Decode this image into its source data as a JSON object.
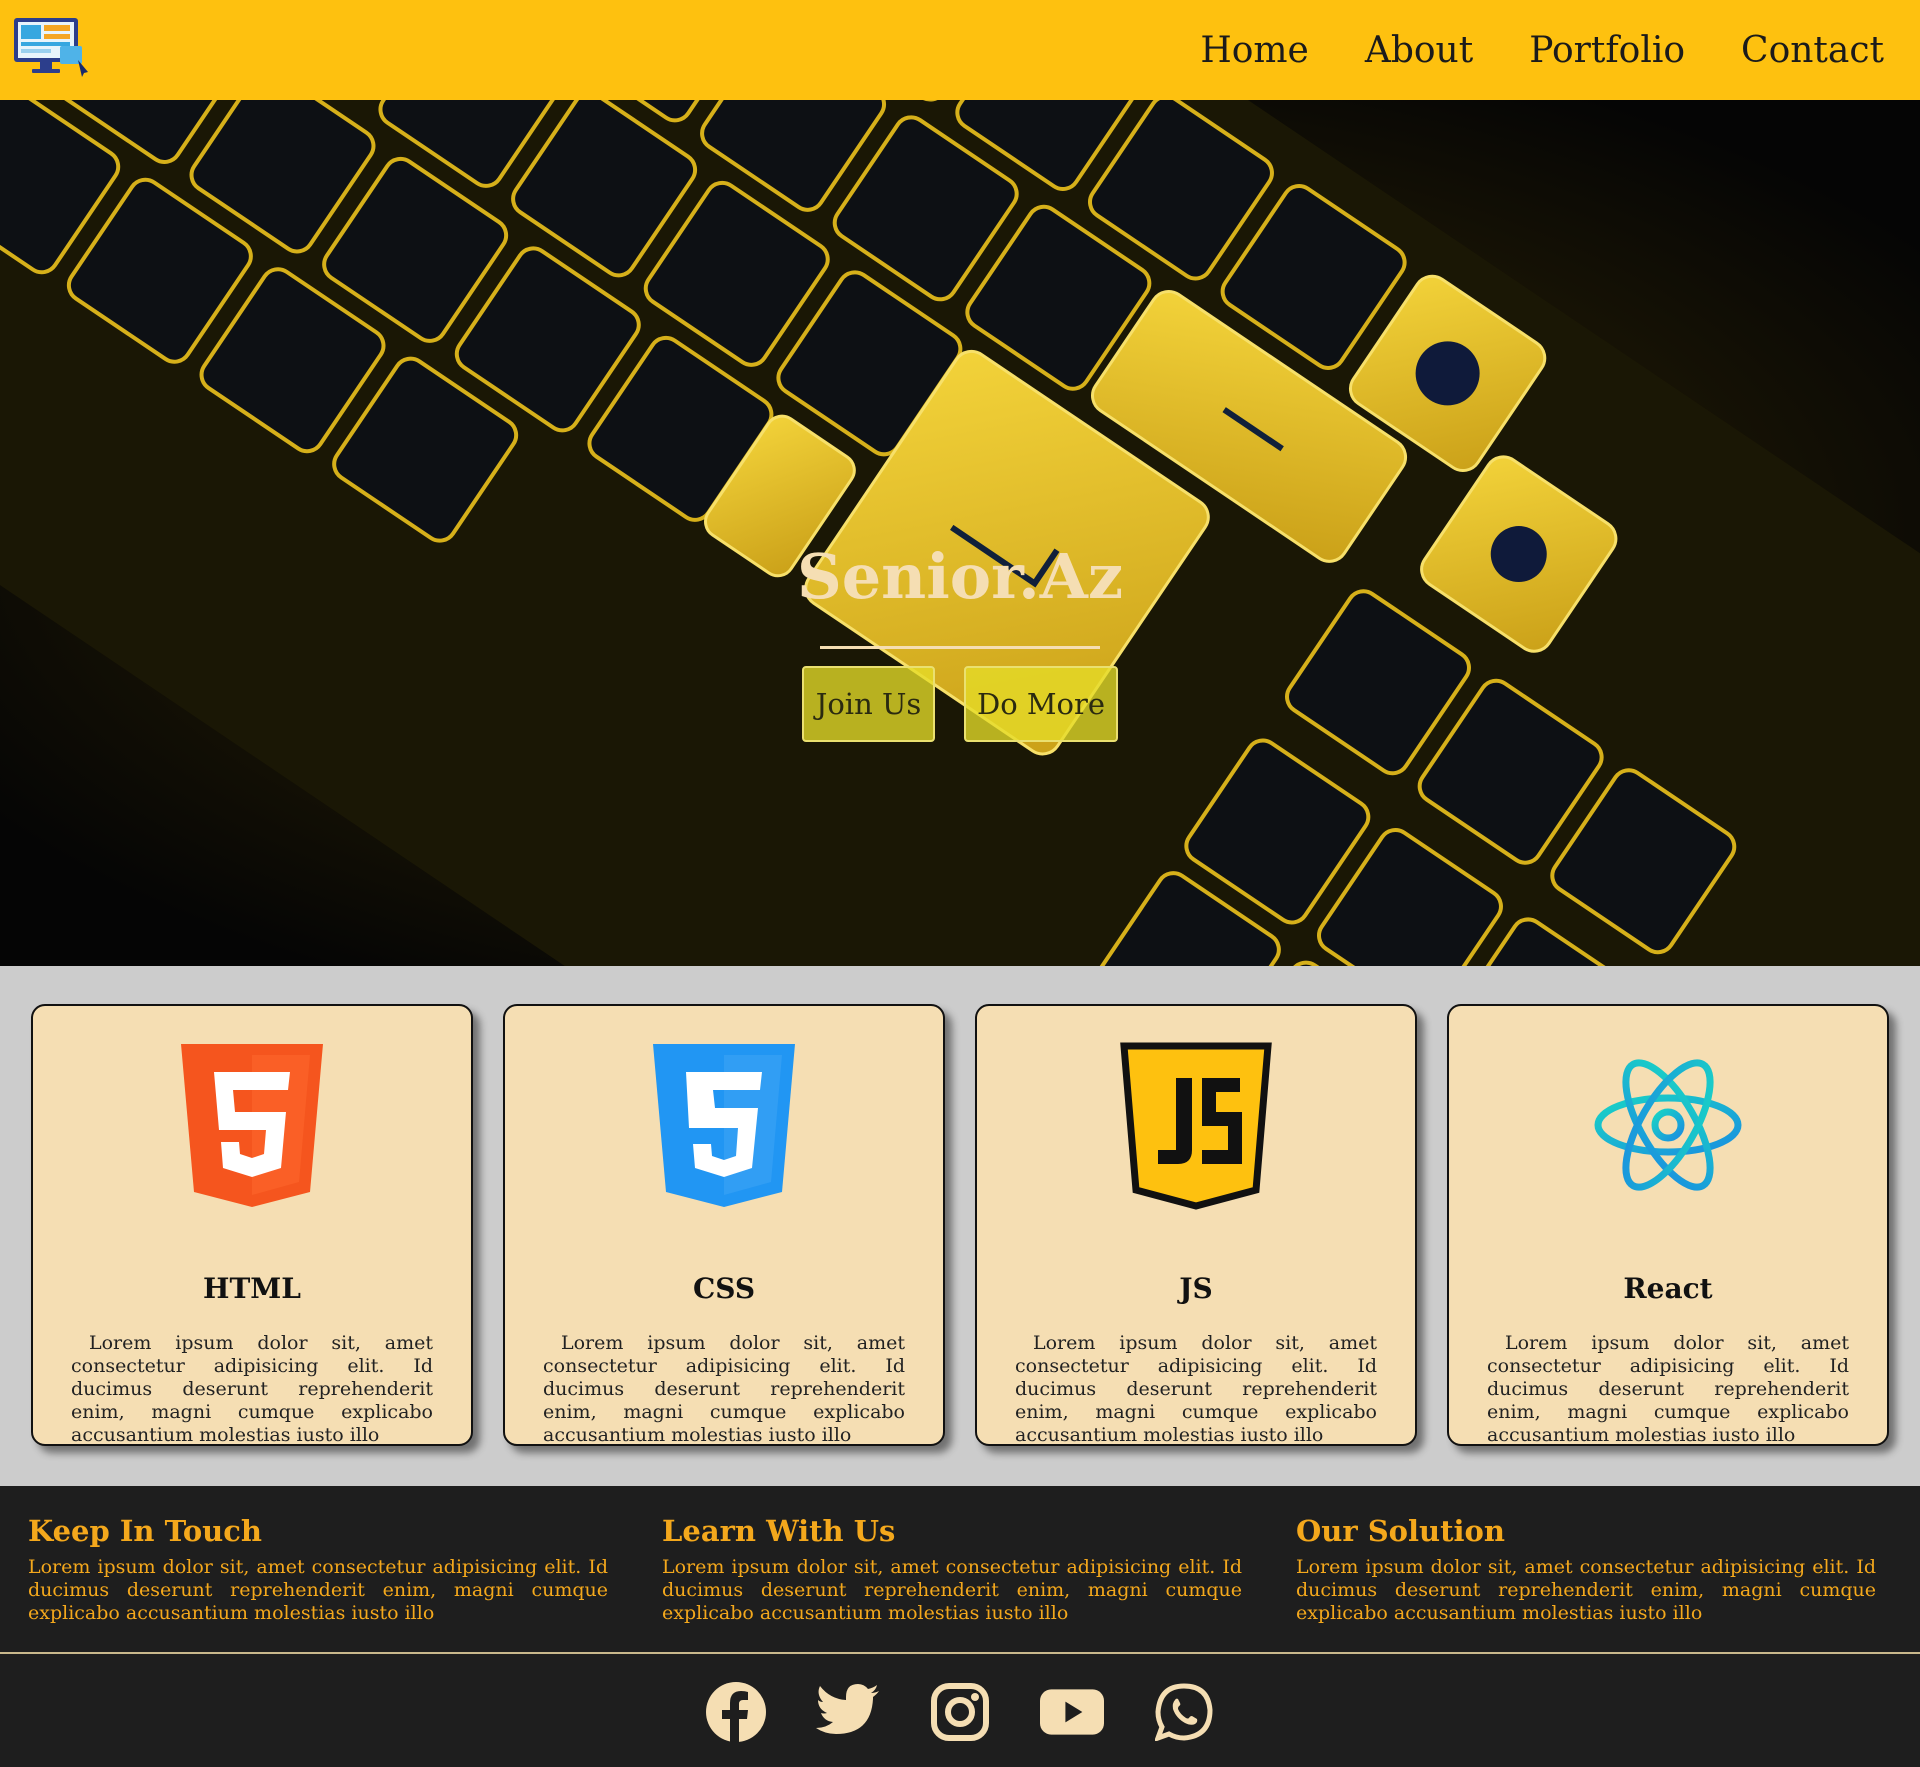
{
  "nav": {
    "items": [
      {
        "label": "Home"
      },
      {
        "label": "About"
      },
      {
        "label": "Portfolio"
      },
      {
        "label": "Contact"
      }
    ]
  },
  "hero": {
    "title": "Senior.Az",
    "join_label": "Join Us",
    "more_label": "Do More"
  },
  "cards": [
    {
      "icon": "html5-icon",
      "title": "HTML",
      "text": "Lorem ipsum dolor sit, amet consectetur adipisicing elit. Id ducimus deserunt reprehenderit enim, magni cumque explicabo accusantium molestias iusto illo"
    },
    {
      "icon": "css3-icon",
      "title": "CSS",
      "text": "Lorem ipsum dolor sit, amet consectetur adipisicing elit. Id ducimus deserunt reprehenderit enim, magni cumque explicabo accusantium molestias iusto illo"
    },
    {
      "icon": "js-icon",
      "title": "JS",
      "text": "Lorem ipsum dolor sit, amet consectetur adipisicing elit. Id ducimus deserunt reprehenderit enim, magni cumque explicabo accusantium molestias iusto illo"
    },
    {
      "icon": "react-icon",
      "title": "React",
      "text": "Lorem ipsum dolor sit, amet consectetur adipisicing elit. Id ducimus deserunt reprehenderit enim, magni cumque explicabo accusantium molestias iusto illo"
    }
  ],
  "footer": {
    "columns": [
      {
        "title": "Keep In Touch",
        "text": "Lorem ipsum dolor sit, amet consectetur adipisicing elit. Id ducimus deserunt reprehenderit enim, magni cumque explicabo accusantium molestias iusto illo"
      },
      {
        "title": "Learn With Us",
        "text": "Lorem ipsum dolor sit, amet consectetur adipisicing elit. Id ducimus deserunt reprehenderit enim, magni cumque explicabo accusantium molestias iusto illo"
      },
      {
        "title": "Our Solution",
        "text": "Lorem ipsum dolor sit, amet consectetur adipisicing elit. Id ducimus deserunt reprehenderit enim, magni cumque explicabo accusantium molestias iusto illo"
      }
    ],
    "social": [
      "facebook-icon",
      "twitter-icon",
      "instagram-icon",
      "youtube-icon",
      "whatsapp-icon"
    ]
  },
  "colors": {
    "header_bg": "#fec10f",
    "card_bg": "#f5deb3",
    "footer_bg": "#1e1e1e",
    "footer_text": "#f4a81c",
    "hero_text": "#f5deb3"
  }
}
